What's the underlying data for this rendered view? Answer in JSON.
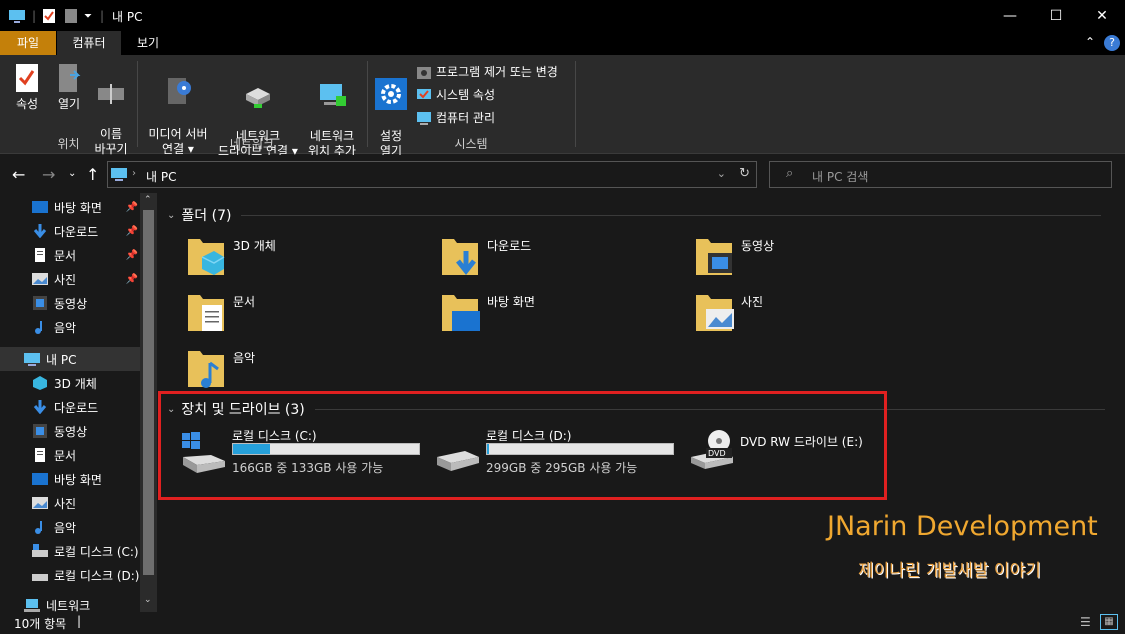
{
  "window": {
    "title": "내 PC",
    "minimize": "—",
    "maximize": "☐",
    "close": "✕"
  },
  "ribbon_tabs": [
    "파일",
    "컴퓨터",
    "보기"
  ],
  "ribbon": {
    "location_group": {
      "label": "위치",
      "buttons": [
        "속성",
        "열기",
        "이름\n바꾸기"
      ]
    },
    "network_group": {
      "label": "네트워크",
      "media_server": "미디어 서버\n연결 ▾",
      "map_drive": "네트워크\n드라이브 연결 ▾",
      "add_location": "네트워크\n위치 추가"
    },
    "system_group": {
      "label": "시스템",
      "settings": "설정\n열기",
      "uninstall": "프로그램 제거 또는 변경",
      "system_props": "시스템 속성",
      "manage": "컴퓨터 관리"
    }
  },
  "address": {
    "path": "내 PC",
    "search_placeholder": "내 PC 검색"
  },
  "sidebar": {
    "quick_access": [
      {
        "label": "바탕 화면",
        "pinned": true
      },
      {
        "label": "다운로드",
        "pinned": true
      },
      {
        "label": "문서",
        "pinned": true
      },
      {
        "label": "사진",
        "pinned": true
      },
      {
        "label": "동영상",
        "pinned": false
      },
      {
        "label": "음악",
        "pinned": false
      }
    ],
    "this_pc": "내 PC",
    "this_pc_items": [
      "3D 개체",
      "다운로드",
      "동영상",
      "문서",
      "바탕 화면",
      "사진",
      "음악",
      "로컬 디스크 (C:)",
      "로컬 디스크 (D:)"
    ],
    "network": "네트워크"
  },
  "content": {
    "folders_header": "폴더 (7)",
    "folders": [
      "3D 개체",
      "다운로드",
      "동영상",
      "문서",
      "바탕 화면",
      "사진",
      "음악"
    ],
    "drives_header": "장치 및 드라이브 (3)",
    "drives": [
      {
        "name": "로컬 디스크 (C:)",
        "info": "166GB 중 133GB 사용 가능",
        "used_fraction": 0.2
      },
      {
        "name": "로컬 디스크 (D:)",
        "info": "299GB 중 295GB 사용 가능",
        "used_fraction": 0.013
      },
      {
        "name": "DVD RW 드라이브 (E:)"
      }
    ]
  },
  "watermark": {
    "line1": "JNarin Development",
    "line2": "제이나린 개발새발 이야기"
  },
  "status": {
    "count": "10개 항목"
  },
  "colors": {
    "file_tab": "#c4800a",
    "drive_fill": "#26a0da",
    "highlight": "#e02020",
    "folder": "#e8c15a"
  }
}
